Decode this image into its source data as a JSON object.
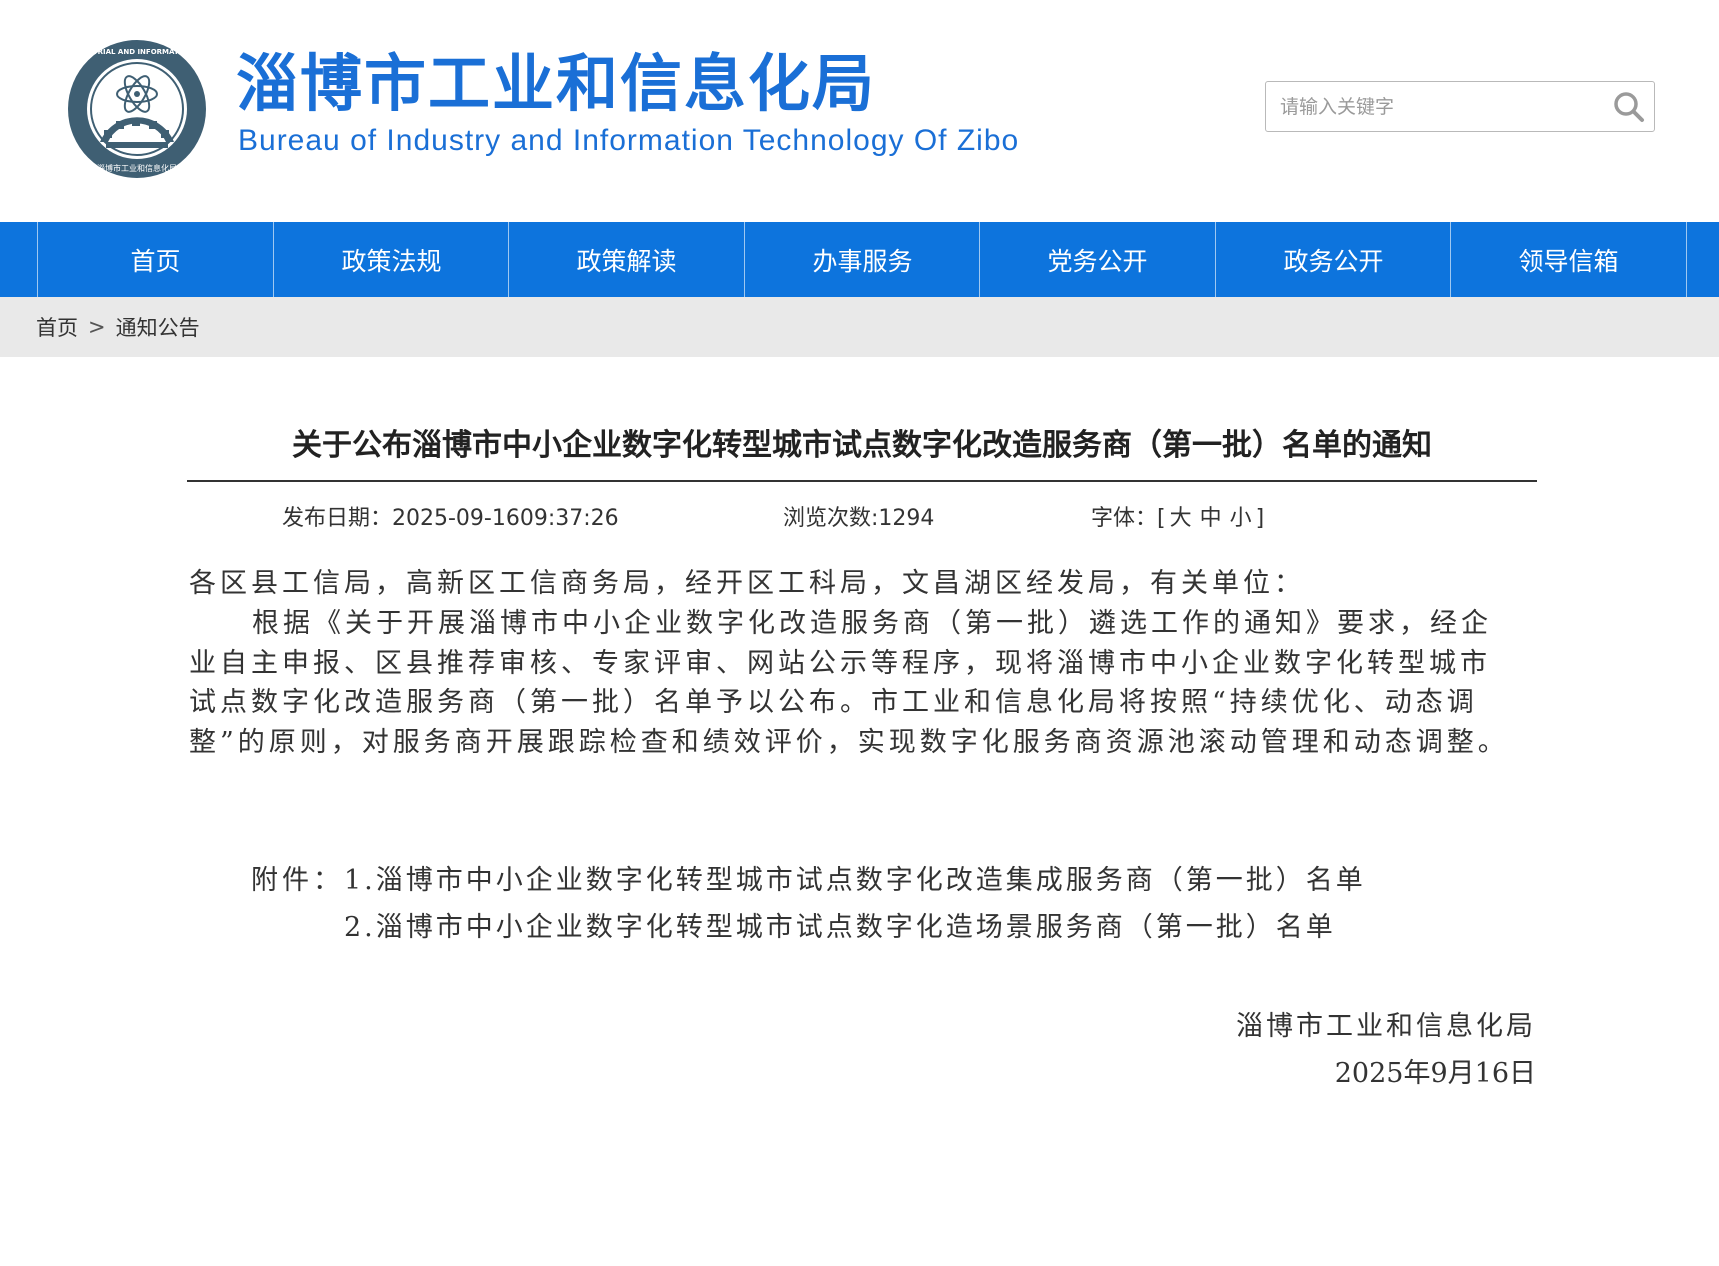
{
  "header": {
    "title_cn": "淄博市工业和信息化局",
    "title_en": "Bureau of Industry and Information Technology Of Zibo",
    "logo_ring_text": "ZIBO INDUSTRIAL AND INFORMATION BUREAU",
    "logo_bottom_text": "淄博市工业和信息化局",
    "search_placeholder": "请输入关键字",
    "brand_color": "#1a6fd6"
  },
  "nav": {
    "items": [
      "首页",
      "政策法规",
      "政策解读",
      "办事服务",
      "党务公开",
      "政务公开",
      "领导信箱"
    ],
    "bg_color": "#0d74dd"
  },
  "breadcrumb": {
    "home": "首页",
    "separator": ">",
    "current": "通知公告"
  },
  "article": {
    "title": "关于公布淄博市中小企业数字化转型城市试点数字化改造服务商（第一批）名单的通知",
    "publish_date": "发布日期：2025-09-1609:37:26",
    "views": "浏览次数:1294",
    "font_label": "字体：[",
    "font_large": "大",
    "font_medium": "中",
    "font_small": "小",
    "font_close": "]",
    "salutation": "各区县工信局，高新区工信商务局，经开区工科局，文昌湖区经发局，有关单位：",
    "paragraph": "根据《关于开展淄博市中小企业数字化改造服务商（第一批）遴选工作的通知》要求，经企业自主申报、区县推荐审核、专家评审、网站公示等程序，现将淄博市中小企业数字化转型城市试点数字化改造服务商（第一批）名单予以公布。市工业和信息化局将按照“持续优化、动态调整”的原则，对服务商开展跟踪检查和绩效评价，实现数字化服务商资源池滚动管理和动态调整。",
    "attachment_label": "附件：",
    "attachment_1": "1.淄博市中小企业数字化转型城市试点数字化改造集成服务商（第一批）名单",
    "attachment_2": "2.淄博市中小企业数字化转型城市试点数字化造场景服务商（第一批）名单",
    "signature_org": "淄博市工业和信息化局",
    "signature_date": "2025年9月16日"
  }
}
